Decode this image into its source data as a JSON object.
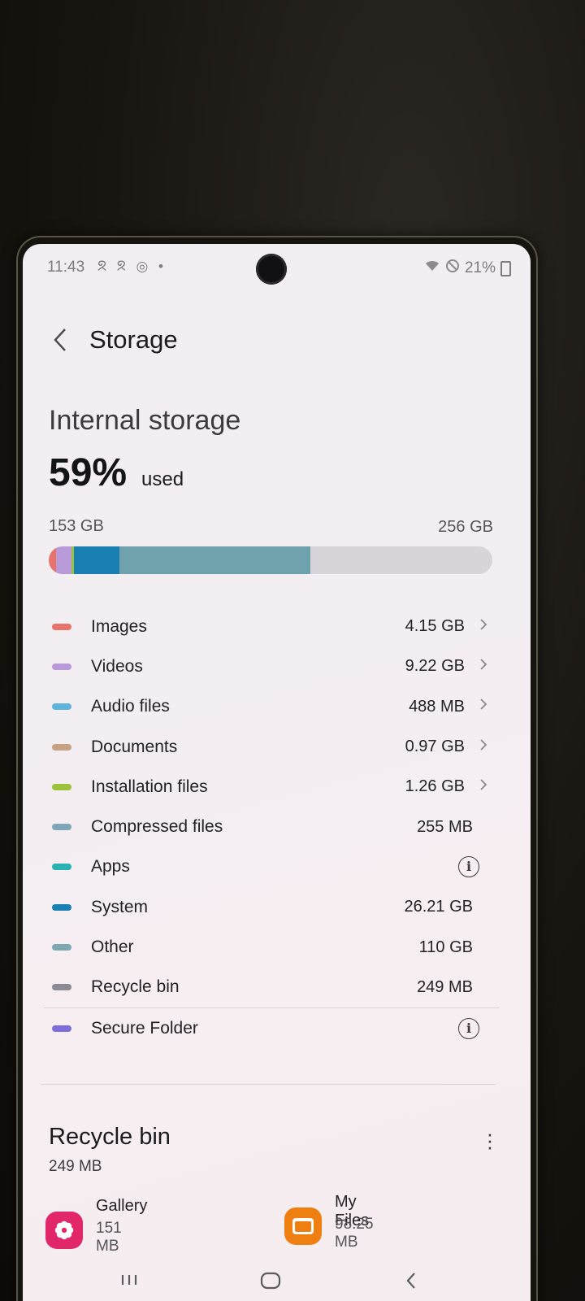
{
  "status": {
    "time": "11:43",
    "notifications": "ᘝ ᘝ ◎ •",
    "battery": "21%"
  },
  "header": {
    "title": "Storage"
  },
  "internal": {
    "label": "Internal storage",
    "percent": "59%",
    "used_word": "used",
    "used": "153 GB",
    "total": "256 GB"
  },
  "categories": [
    {
      "name": "Images",
      "size": "4.15 GB",
      "color": "#e8736b",
      "chevron": true
    },
    {
      "name": "Videos",
      "size": "9.22 GB",
      "color": "#b99ad8",
      "chevron": true
    },
    {
      "name": "Audio files",
      "size": "488 MB",
      "color": "#5fb4df",
      "chevron": true
    },
    {
      "name": "Documents",
      "size": "0.97 GB",
      "color": "#c7a283",
      "chevron": true
    },
    {
      "name": "Installation files",
      "size": "1.26 GB",
      "color": "#9cc23b",
      "chevron": true
    },
    {
      "name": "Compressed files",
      "size": "255 MB",
      "color": "#7fa6b8",
      "chevron": false
    },
    {
      "name": "Apps",
      "size": "",
      "color": "#28b3b0",
      "info": true
    },
    {
      "name": "System",
      "size": "26.21 GB",
      "color": "#1a7fb3",
      "chevron": false
    },
    {
      "name": "Other",
      "size": "110 GB",
      "color": "#7da8b2",
      "chevron": false
    },
    {
      "name": "Recycle bin",
      "size": "249 MB",
      "color": "#8c8a95",
      "chevron": false
    },
    {
      "name": "Secure Folder",
      "size": "",
      "color": "#7d6fdb",
      "info": true
    }
  ],
  "bar_segments": [
    {
      "category": "Images",
      "fraction": 0.016,
      "color": "#e8736b"
    },
    {
      "category": "Videos",
      "fraction": 0.036,
      "color": "#b99ad8"
    },
    {
      "category": "Installation files",
      "fraction": 0.005,
      "color": "#9cc23b"
    },
    {
      "category": "System",
      "fraction": 0.102,
      "color": "#1a7fb3"
    },
    {
      "category": "Other",
      "fraction": 0.43,
      "color": "#6fa2ad"
    }
  ],
  "recycle_bin": {
    "title": "Recycle bin",
    "size": "249 MB",
    "apps": [
      {
        "name": "Gallery",
        "size": "151 MB",
        "icon": "gallery-icon",
        "color": "#e2266a"
      },
      {
        "name": "My Files",
        "size": "98.25 MB",
        "icon": "my-files-icon",
        "color": "#f07f12"
      }
    ]
  }
}
